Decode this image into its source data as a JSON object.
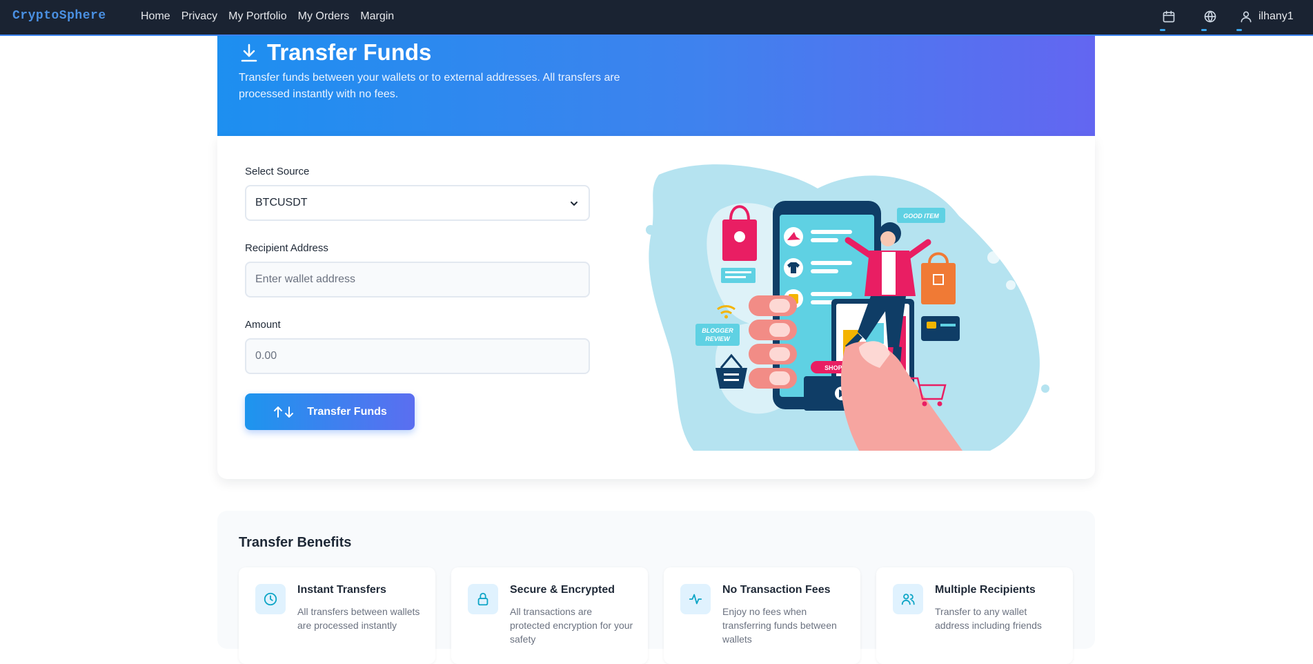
{
  "nav": {
    "brand": "CryptoSphere",
    "links": [
      "Home",
      "Privacy",
      "My Portfolio",
      "My Orders",
      "Margin"
    ],
    "username": "ilhany1",
    "icons": [
      "calendar-icon",
      "globe-icon",
      "user-icon"
    ]
  },
  "hero": {
    "title": "Transfer Funds",
    "description": "Transfer funds between your wallets or to external addresses. All transfers are processed instantly with no fees."
  },
  "form": {
    "source_label": "Select Source",
    "source_value": "BTCUSDT",
    "recipient_label": "Recipient Address",
    "recipient_placeholder": "Enter wallet address",
    "amount_label": "Amount",
    "amount_placeholder": "0.00",
    "submit_label": "Transfer Funds",
    "illustration": {
      "shop_label": "SHOP NOW",
      "good_label": "GOOD ITEM",
      "review_line1": "BLOGGER",
      "review_line2": "REVIEW"
    }
  },
  "benefits": {
    "title": "Transfer Benefits",
    "items": [
      {
        "title": "Instant Transfers",
        "desc": "All transfers between wallets are processed instantly",
        "icon": "clock-icon"
      },
      {
        "title": "Secure & Encrypted",
        "desc": "All transactions are protected encryption for your safety",
        "icon": "lock-icon"
      },
      {
        "title": "No Transaction Fees",
        "desc": "Enjoy no fees when transferring funds between wallets",
        "icon": "activity-icon"
      },
      {
        "title": "Multiple Recipients",
        "desc": "Transfer to any wallet address including friends",
        "icon": "users-icon"
      }
    ]
  },
  "colors": {
    "navbar": "#1a2332",
    "brand": "#4a90e2",
    "hero_start": "#1d8ff0",
    "hero_end": "#6366f1",
    "accent": "#3b82f6"
  }
}
